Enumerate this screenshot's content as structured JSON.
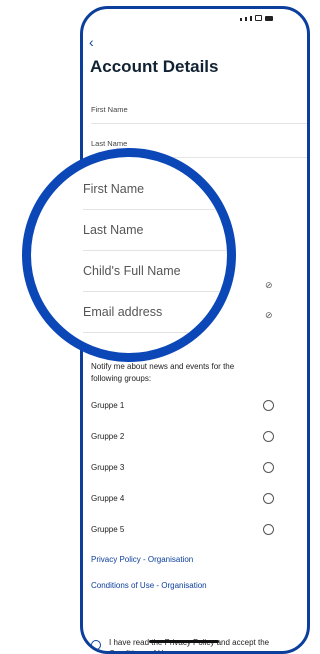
{
  "header": {
    "back_icon": "chevron-left-icon",
    "title": "Account Details"
  },
  "form": {
    "first_name_label": "First Name",
    "last_name_label": "Last Name",
    "child_name_label": "Child's Full Name",
    "email_label": "Email address"
  },
  "notify": {
    "text": "Notify me about news and events for the following groups:",
    "groups": [
      "Gruppe 1",
      "Gruppe 2",
      "Gruppe 3",
      "Gruppe 4",
      "Gruppe 5"
    ]
  },
  "links": {
    "privacy": "Privacy Policy - Organisation",
    "conditions": "Conditions of Use - Organisation"
  },
  "consent": {
    "text": "I have read the Privacy Policy and accept the Conditions of Use"
  },
  "colors": {
    "accent": "#0c3f9c",
    "zoom_ring": "#0c47b8"
  }
}
